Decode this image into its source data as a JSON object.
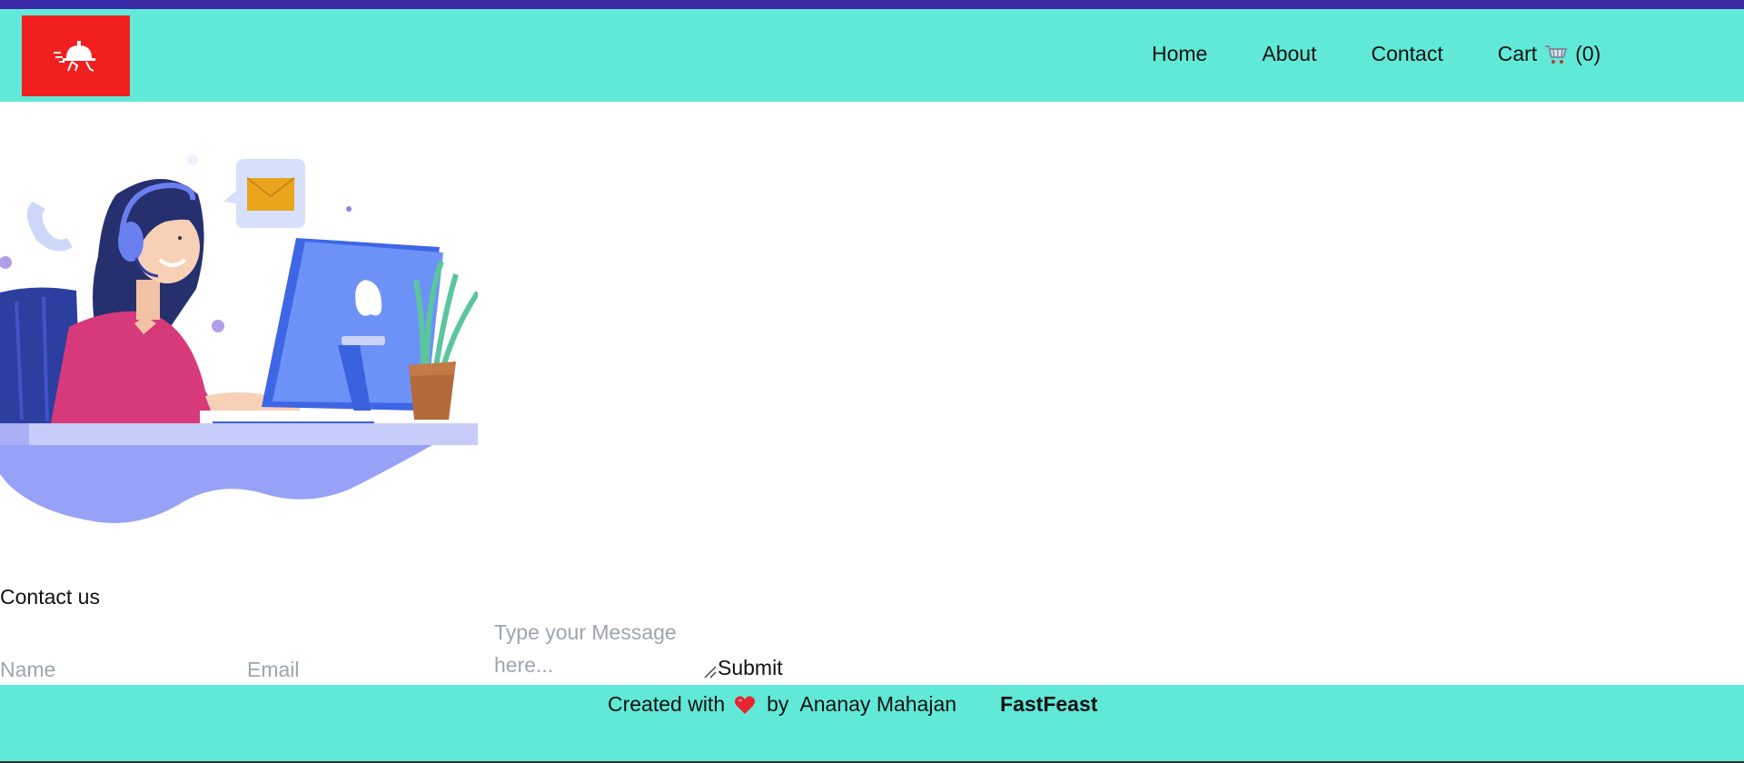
{
  "nav": {
    "items": [
      "Home",
      "About",
      "Contact"
    ],
    "cart_label": "Cart",
    "cart_count": "(0)"
  },
  "contact": {
    "title": "Contact us",
    "name_placeholder": "Name",
    "email_placeholder": "Email",
    "message_placeholder": "Type your Message here...",
    "submit_label": "Submit"
  },
  "footer": {
    "created_with": "Created with",
    "by": "by",
    "author": "Ananay Mahajan",
    "brand": "FastFeast"
  },
  "colors": {
    "top_strip": "#3a2aa6",
    "header_bg": "#61e9d8",
    "logo_bg": "#f21f1f",
    "footer_bg": "#61e9d8"
  },
  "icons": {
    "logo": "food-delivery-cloche-icon",
    "cart": "shopping-cart-icon",
    "heart": "heart-icon"
  }
}
